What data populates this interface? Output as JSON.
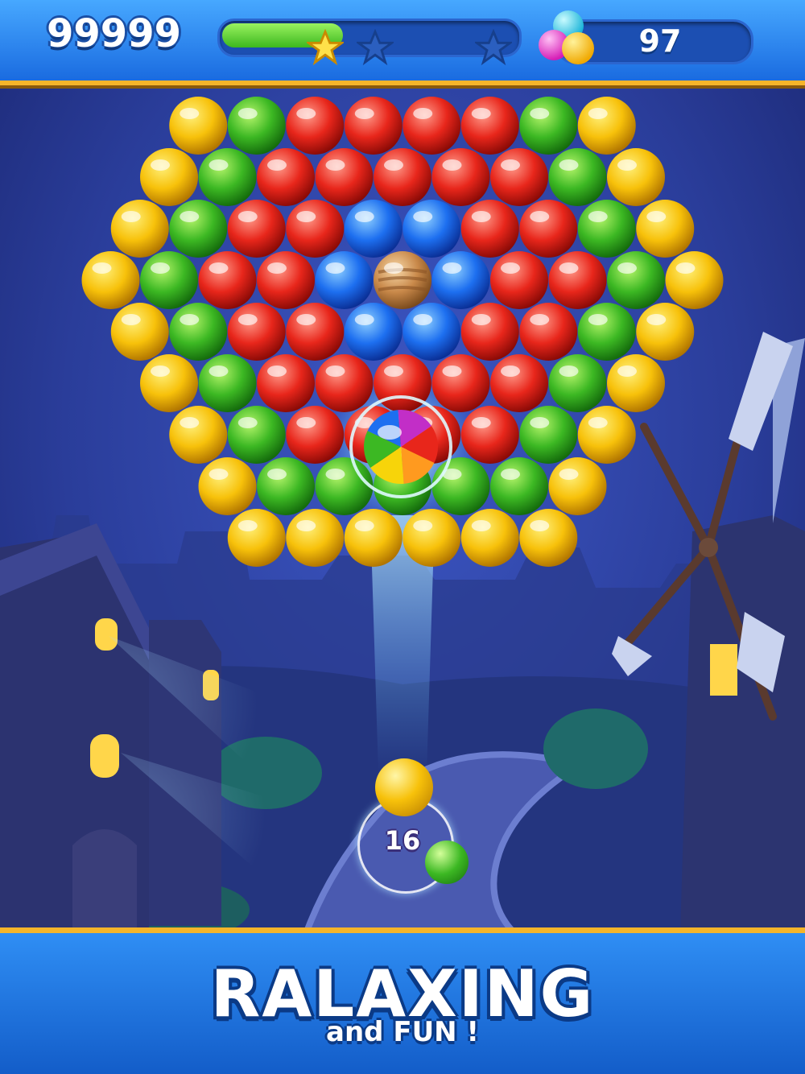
{
  "hud": {
    "score": "99999",
    "level_progress": 0.41,
    "stars_earned": 1,
    "stars_total": 3,
    "moves_left": "97"
  },
  "board": {
    "rows": [
      "YGRRRRGY",
      "YGRRRRRGY",
      "YGRRBBRRGY",
      "YGRRBPBRRGY",
      "YGRRBBRRGY",
      "YGRRRRRGY",
      "YGRRRRGY",
      "YGGGGGY",
      "YYYYYY"
    ],
    "palette": {
      "Y": [
        "#fff07a",
        "#f7c10a",
        "#b07400"
      ],
      "G": [
        "#b6f56b",
        "#3cb823",
        "#146b0c"
      ],
      "R": [
        "#ff9a8a",
        "#e8261b",
        "#8a0a06"
      ],
      "B": [
        "#8fd0ff",
        "#1d6ff0",
        "#0a2f96"
      ],
      "P": [
        "#f7d8a8",
        "#c9894a",
        "#7a4a1c"
      ]
    },
    "special_bubble": "rainbow-ball"
  },
  "launcher": {
    "shots_left": "16",
    "current_ball": "yellow",
    "next_ball": "green"
  },
  "banner": {
    "headline": "RALAXING",
    "subline": "and FUN !"
  },
  "colors": {
    "hud_blue": "#1a6be0",
    "gold_trim": "#f5b52a",
    "night_sky": "#2c3f9a"
  }
}
